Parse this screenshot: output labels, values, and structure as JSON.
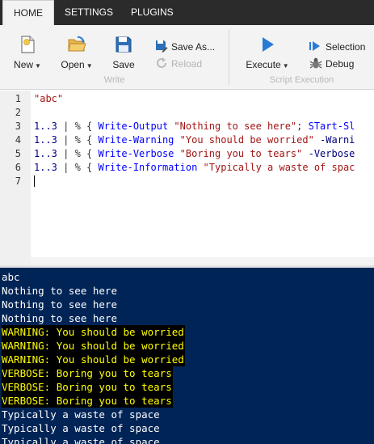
{
  "tabs": [
    {
      "label": "HOME",
      "active": true
    },
    {
      "label": "SETTINGS",
      "active": false
    },
    {
      "label": "PLUGINS",
      "active": false
    }
  ],
  "ribbon": {
    "write_group": {
      "label": "Write",
      "new_label": "New",
      "open_label": "Open",
      "save_label": "Save",
      "save_as_label": "Save As...",
      "reload_label": "Reload"
    },
    "script_group": {
      "label": "Script Execution",
      "execute_label": "Execute",
      "selection_label": "Selection",
      "debug_label": "Debug"
    }
  },
  "editor": {
    "line_numbers": [
      "1",
      "2",
      "3",
      "4",
      "5",
      "6",
      "7"
    ],
    "lines": [
      {
        "tokens": [
          {
            "t": "\"abc\"",
            "c": "str"
          }
        ]
      },
      {
        "tokens": []
      },
      {
        "tokens": [
          {
            "t": "1..3",
            "c": "num"
          },
          {
            "t": " | % { ",
            "c": "op"
          },
          {
            "t": "Write-Output",
            "c": "cmd"
          },
          {
            "t": " ",
            "c": "op"
          },
          {
            "t": "\"Nothing to see here\"",
            "c": "str"
          },
          {
            "t": "; ",
            "c": "op"
          },
          {
            "t": "STart-Sl",
            "c": "cmd"
          }
        ]
      },
      {
        "tokens": [
          {
            "t": "1..3",
            "c": "num"
          },
          {
            "t": " | % { ",
            "c": "op"
          },
          {
            "t": "Write-Warning",
            "c": "cmd"
          },
          {
            "t": " ",
            "c": "op"
          },
          {
            "t": "\"You should be worried\"",
            "c": "str"
          },
          {
            "t": " ",
            "c": "op"
          },
          {
            "t": "-Warni",
            "c": "param"
          }
        ]
      },
      {
        "tokens": [
          {
            "t": "1..3",
            "c": "num"
          },
          {
            "t": " | % { ",
            "c": "op"
          },
          {
            "t": "Write-Verbose",
            "c": "cmd"
          },
          {
            "t": " ",
            "c": "op"
          },
          {
            "t": "\"Boring you to tears\"",
            "c": "str"
          },
          {
            "t": " ",
            "c": "op"
          },
          {
            "t": "-Verbose",
            "c": "param"
          }
        ]
      },
      {
        "tokens": [
          {
            "t": "1..3",
            "c": "num"
          },
          {
            "t": " | % { ",
            "c": "op"
          },
          {
            "t": "Write-Information",
            "c": "cmd"
          },
          {
            "t": " ",
            "c": "op"
          },
          {
            "t": "\"Typically a waste of spac",
            "c": "str"
          }
        ]
      },
      {
        "tokens": []
      }
    ]
  },
  "console": {
    "lines": [
      {
        "text": "abc",
        "kind": "out"
      },
      {
        "text": "Nothing to see here",
        "kind": "out"
      },
      {
        "text": "Nothing to see here",
        "kind": "out"
      },
      {
        "text": "Nothing to see here",
        "kind": "out"
      },
      {
        "text": "WARNING: You should be worried",
        "kind": "warn"
      },
      {
        "text": "WARNING: You should be worried",
        "kind": "warn"
      },
      {
        "text": "WARNING: You should be worried",
        "kind": "warn"
      },
      {
        "text": "VERBOSE: Boring you to tears",
        "kind": "verb"
      },
      {
        "text": "VERBOSE: Boring you to tears",
        "kind": "verb"
      },
      {
        "text": "VERBOSE: Boring you to tears",
        "kind": "verb"
      },
      {
        "text": "Typically a waste of space",
        "kind": "out"
      },
      {
        "text": "Typically a waste of space",
        "kind": "out"
      },
      {
        "text": "Typically a waste of space",
        "kind": "out"
      }
    ]
  },
  "colors": {
    "console_bg": "#012456",
    "console_fg": "#ffffff",
    "warning_fg": "#ffff00",
    "warning_bg": "#000000",
    "tabbar_bg": "#2b2b2b",
    "ribbon_bg": "#f3f3f3",
    "accent_blue": "#2a7bd6"
  },
  "icons": [
    "new-file-icon",
    "open-folder-icon",
    "save-disk-icon",
    "save-as-icon",
    "reload-icon",
    "execute-play-icon",
    "selection-icon",
    "debug-bug-icon",
    "dropdown-caret-icon"
  ]
}
